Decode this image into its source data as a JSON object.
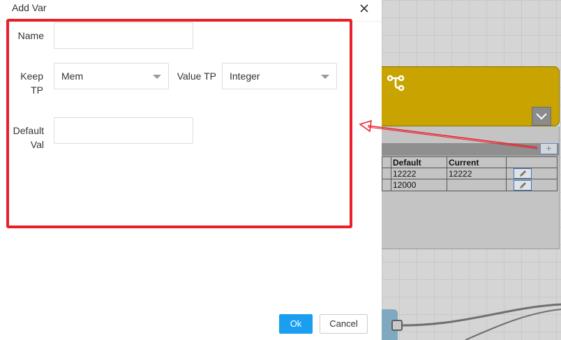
{
  "dialog": {
    "title": "Add Var",
    "close_icon": "close-icon",
    "fields": {
      "name": {
        "label": "Name",
        "value": ""
      },
      "keep_tp": {
        "label_line1": "Keep",
        "label_line2": "TP",
        "value": "Mem"
      },
      "value_tp": {
        "label": "Value TP",
        "value": "Integer"
      },
      "default_val": {
        "label_line1": "Default",
        "label_line2": "Val",
        "value": ""
      }
    },
    "buttons": {
      "ok": "Ok",
      "cancel": "Cancel"
    }
  },
  "canvas": {
    "node_icon": "branch-icon",
    "collapse_icon": "chevron-down-icon",
    "add_icon": "plus-icon",
    "table": {
      "headers": [
        "",
        "Default",
        "Current",
        ""
      ],
      "rows": [
        {
          "default": "12222",
          "current": "12222"
        },
        {
          "default": "12000",
          "current": ""
        }
      ]
    },
    "colors": {
      "node": "#c9a400",
      "annotation": "#e8202a",
      "ok_button": "#1a9ff0"
    }
  }
}
